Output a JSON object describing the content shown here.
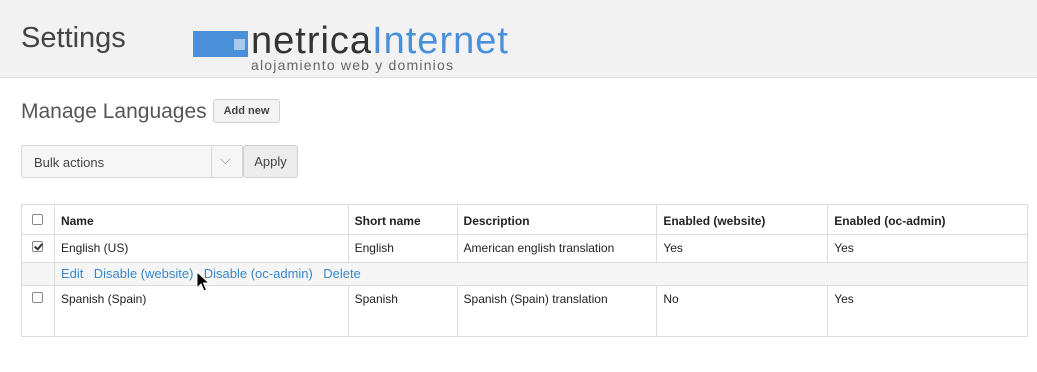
{
  "header": {
    "title": "Settings",
    "logo": {
      "word_dark": "netrica",
      "word_blue": "Internet",
      "tagline": "alojamiento web y dominios",
      "icon": "netrica-logo-icon"
    }
  },
  "page": {
    "title": "Manage Languages",
    "add_new_label": "Add new"
  },
  "bulk": {
    "selected": "Bulk actions",
    "apply_label": "Apply",
    "chevron_icon": "chevron-down-icon"
  },
  "table": {
    "headers": [
      "Name",
      "Short name",
      "Description",
      "Enabled (website)",
      "Enabled (oc-admin)"
    ],
    "rows": [
      {
        "checked": true,
        "name": "English (US)",
        "short_name": "English",
        "description": "American english translation",
        "enabled_website": "Yes",
        "enabled_admin": "Yes",
        "actions": [
          "Edit",
          "Disable (website)",
          "Disable (oc-admin)",
          "Delete"
        ]
      },
      {
        "checked": false,
        "name": "Spanish (Spain)",
        "short_name": "Spanish",
        "description": "Spanish (Spain) translation",
        "enabled_website": "No",
        "enabled_admin": "Yes"
      }
    ]
  },
  "colors": {
    "accent": "#4a90d9",
    "link": "#3a87c8",
    "header_bg": "#f2f2f2"
  }
}
